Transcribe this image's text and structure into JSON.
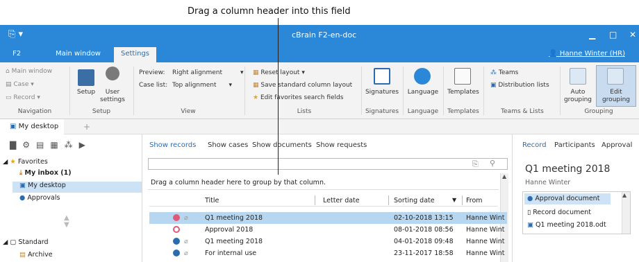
{
  "callout": {
    "text": "Drag a column header into this field"
  },
  "app": {
    "title": "cBrain F2-en-doc",
    "quick_access": "⎘ ▾"
  },
  "tabs": [
    {
      "label": "F2"
    },
    {
      "label": "Main window"
    },
    {
      "label": "Settings"
    }
  ],
  "user": {
    "label": "Hanne Winter (HR)"
  },
  "ribbon": {
    "navigation": {
      "group_label": "Navigation",
      "items": [
        {
          "label": "Main window"
        },
        {
          "label": "Case ▾"
        },
        {
          "label": "Record ▾"
        }
      ]
    },
    "setup": {
      "group_label": "Setup",
      "setup_label": "Setup",
      "user_settings_label": "User settings"
    },
    "view": {
      "group_label": "View",
      "preview_label": "Preview:",
      "preview_value": "Right alignment",
      "caselist_label": "Case list:",
      "caselist_value": "Top alignment"
    },
    "lists": {
      "group_label": "Lists",
      "items": [
        {
          "label": "Reset layout ▾"
        },
        {
          "label": "Save standard column layout"
        },
        {
          "label": "Edit favorites search fields"
        }
      ]
    },
    "signatures": {
      "group_label": "Signatures",
      "label": "Signatures"
    },
    "language": {
      "group_label": "Language",
      "label": "Language"
    },
    "templates": {
      "group_label": "Templates",
      "label": "Templates"
    },
    "teams": {
      "group_label": "Teams & Lists",
      "teams_label": "Teams",
      "dist_label": "Distribution lists"
    },
    "grouping": {
      "group_label": "Grouping",
      "auto_label": "Auto grouping",
      "edit_label": "Edit grouping"
    }
  },
  "doc_tab": {
    "label": "My desktop",
    "add": "+"
  },
  "left": {
    "favorites": "Favorites",
    "inbox": "My inbox (1)",
    "desktop": "My desktop",
    "approvals": "Approvals",
    "standard": "Standard",
    "archive": "Archive"
  },
  "mid": {
    "tabs": [
      {
        "label": "Show records"
      },
      {
        "label": "Show cases"
      },
      {
        "label": "Show documents"
      },
      {
        "label": "Show requests"
      }
    ],
    "group_hint": "Drag a column header here to group by that column.",
    "headers": {
      "title": "Title",
      "letter_date": "Letter date",
      "sorting_date": "Sorting date",
      "from": "From"
    },
    "rows": [
      {
        "title": "Q1 meeting 2018",
        "sorting_date": "02-10-2018 13:15",
        "from": "Hanne Wint"
      },
      {
        "title": "Approval 2018",
        "sorting_date": "08-01-2018 08:56",
        "from": "Hanne Wint"
      },
      {
        "title": "Q1 meeting 2018",
        "sorting_date": "04-01-2018 09:48",
        "from": "Hanne Wint"
      },
      {
        "title": "For internal use",
        "sorting_date": "23-11-2017 18:58",
        "from": "Hanne Wint"
      }
    ]
  },
  "right": {
    "tabs": [
      {
        "label": "Record"
      },
      {
        "label": "Participants"
      },
      {
        "label": "Approval"
      }
    ],
    "title": "Q1 meeting 2018",
    "owner": "Hanne Winter",
    "docs": [
      {
        "label": "Approval document"
      },
      {
        "label": "Record document"
      },
      {
        "label": "Q1 meeting 2018.odt"
      }
    ]
  },
  "colors": {
    "accent": "#2b88d8",
    "selection": "#b7d7f0",
    "check": "#2b6cb0",
    "pink": "#e05a78"
  }
}
